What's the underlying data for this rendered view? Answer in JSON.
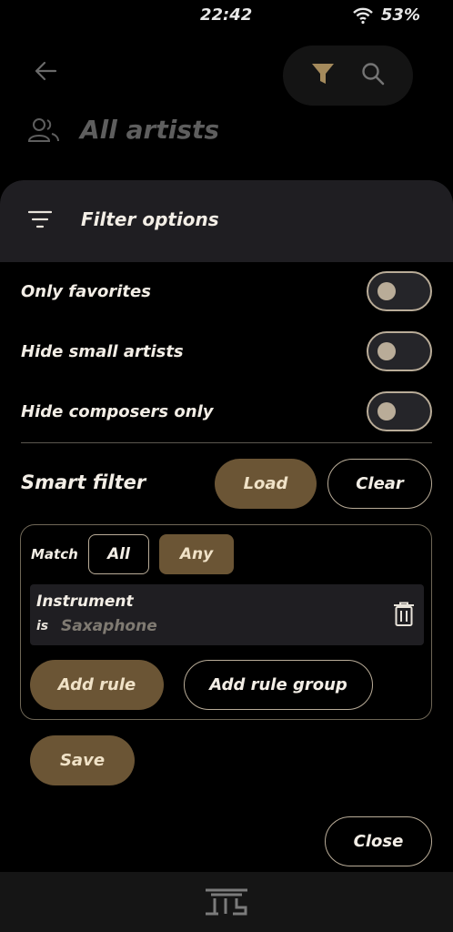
{
  "status": {
    "time": "22:42",
    "battery": "53%"
  },
  "header": {
    "title": "All artists"
  },
  "sheet": {
    "title": "Filter options",
    "toggles": [
      {
        "label": "Only favorites",
        "on": false
      },
      {
        "label": "Hide small artists",
        "on": false
      },
      {
        "label": "Hide composers only",
        "on": false
      }
    ],
    "smart_filter": {
      "label": "Smart filter",
      "load_label": "Load",
      "clear_label": "Clear",
      "match_label": "Match",
      "match_all": "All",
      "match_any": "Any",
      "rule": {
        "field": "Instrument",
        "operator": "is",
        "value": "Saxaphone"
      },
      "add_rule_label": "Add rule",
      "add_group_label": "Add rule group",
      "save_label": "Save"
    },
    "close_label": "Close"
  },
  "colors": {
    "accent": "#6b5535",
    "accent_text": "#f0e2c7",
    "outline": "#b9ac98",
    "header_bg": "#1f1e22"
  }
}
